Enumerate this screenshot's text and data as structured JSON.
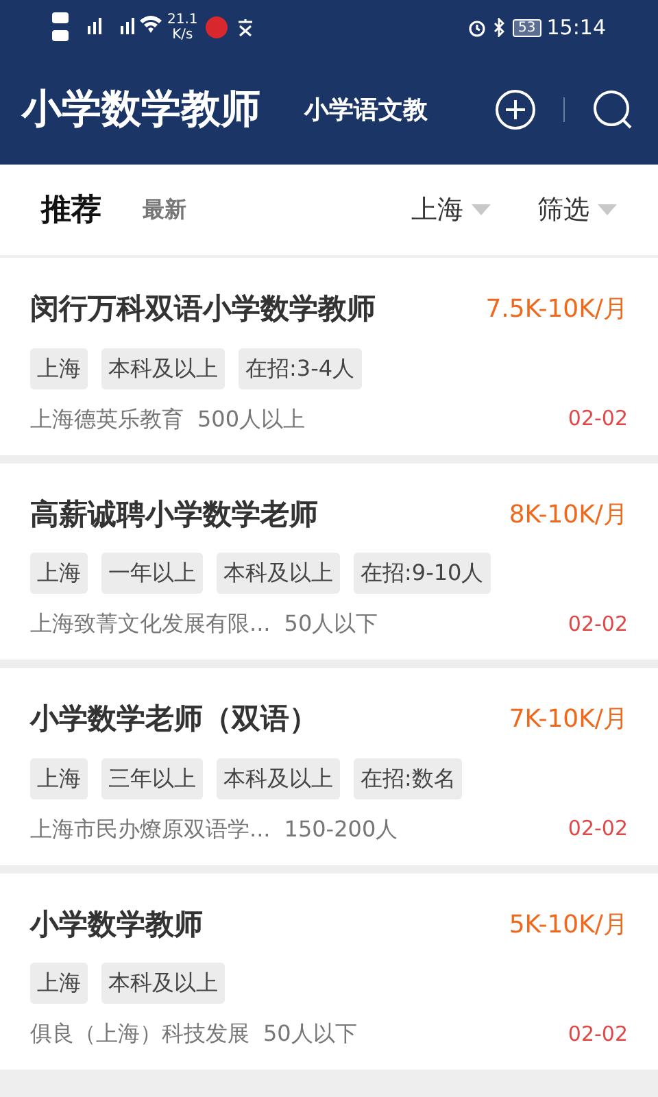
{
  "status_bar": {
    "speed": "21.1",
    "speed_unit": "K/s",
    "battery": "53",
    "time": "15:14"
  },
  "header": {
    "title": "小学数学教师",
    "other_job": "小学语文教"
  },
  "tabs": [
    {
      "label": "推荐",
      "selected": true
    },
    {
      "label": "最新",
      "selected": false
    }
  ],
  "filters": [
    {
      "label": "上海"
    },
    {
      "label": "筛选"
    }
  ],
  "jobs": [
    {
      "title": "闵行万科双语小学数学教师",
      "salary": "7.5K-10K/月",
      "tags": [
        "上海",
        "本科及以上",
        "在招:3-4人"
      ],
      "company": "上海德英乐教育",
      "size": "500人以上",
      "date": "02-02"
    },
    {
      "title": "高薪诚聘小学数学老师",
      "salary": "8K-10K/月",
      "tags": [
        "上海",
        "一年以上",
        "本科及以上",
        "在招:9-10人"
      ],
      "company": "上海致菁文化发展有限...",
      "size": "50人以下",
      "date": "02-02"
    },
    {
      "title": "小学数学老师（双语）",
      "salary": "7K-10K/月",
      "tags": [
        "上海",
        "三年以上",
        "本科及以上",
        "在招:数名"
      ],
      "company": "上海市民办燎原双语学...",
      "size": "150-200人",
      "date": "02-02"
    },
    {
      "title": "小学数学教师",
      "salary": "5K-10K/月",
      "tags": [
        "上海",
        "本科及以上"
      ],
      "company": "俱良（上海）科技发展",
      "size": "50人以下",
      "date": "02-02"
    }
  ]
}
